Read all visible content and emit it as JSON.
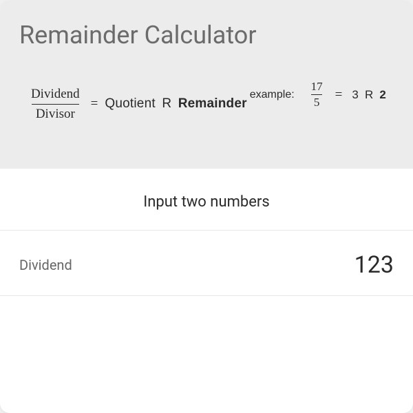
{
  "title": "Remainder Calculator",
  "formula": {
    "fraction": {
      "numerator": "Dividend",
      "denominator": "Divisor"
    },
    "equals": "=",
    "quotient": "Quotient",
    "r": "R",
    "remainder": "Remainder",
    "example_label": "example:",
    "example_fraction": {
      "numerator": "17",
      "denominator": "5"
    },
    "example_quotient": "3",
    "example_r": "R",
    "example_remainder": "2"
  },
  "section_heading": "Input two numbers",
  "fields": {
    "dividend": {
      "label": "Dividend",
      "value": "123"
    }
  }
}
